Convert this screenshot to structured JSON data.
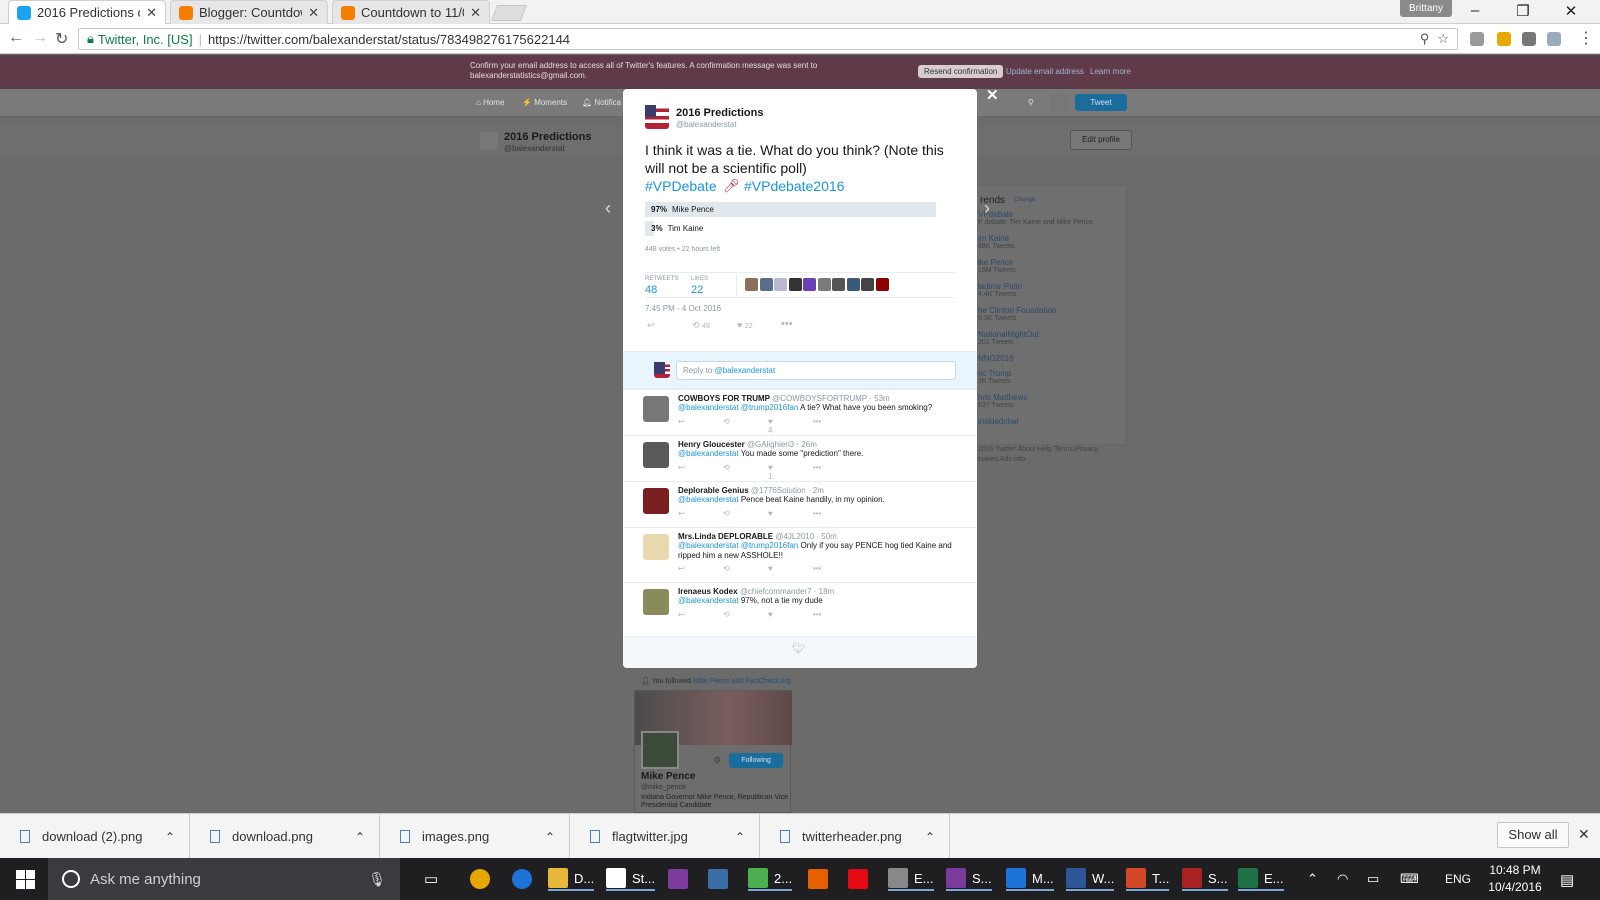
{
  "browser": {
    "tabs": [
      {
        "title": "2016 Predictions on",
        "active": true,
        "icon": "twitter-icon",
        "color": "#1da1f2"
      },
      {
        "title": "Blogger: Countdown",
        "active": false,
        "icon": "blogger-icon",
        "color": "#f57d00"
      },
      {
        "title": "Countdown to 11/0",
        "active": false,
        "icon": "blogger-icon",
        "color": "#f57d00"
      }
    ],
    "profile_name": "Brittany",
    "secure_label": "Twitter, Inc. [US]",
    "url": "https://twitter.com/balexanderstat/status/783498276175622144"
  },
  "twitter_bg": {
    "banner_message": "Confirm your email address to access all of Twitter's features. A confirmation message was sent to balexanderstatistics@gmail.com.",
    "resend_label": "Resend confirmation",
    "update_email_label": "Update email address",
    "learn_more_label": "Learn more",
    "nav": {
      "home": "Home",
      "moments": "Moments",
      "notifications": "Notifica"
    },
    "tweet_button": "Tweet",
    "profile_name": "2016 Predictions",
    "profile_handle": "@balexanderstat",
    "edit_profile": "Edit profile",
    "trends_title": "rends",
    "trends_change": "Change",
    "trends": [
      {
        "name": "VPdebate",
        "sub": "P debate: Tim Kaine and Mike Pence"
      },
      {
        "name": "im Kaine",
        "sub": "88K Tweets"
      },
      {
        "name": "ike Pence",
        "sub": "16M Tweets"
      },
      {
        "name": "ladimir Putin",
        "sub": "4.4K Tweets"
      },
      {
        "name": "he Clinton Foundation",
        "sub": "9.3K Tweets"
      },
      {
        "name": "NationalNightOut",
        "sub": "201 Tweets"
      },
      {
        "name": "NNO2016",
        "sub": ""
      },
      {
        "name": "ric Trump",
        "sub": "3K Tweets"
      },
      {
        "name": "hris Matthews",
        "sub": "637 Tweets"
      },
      {
        "name": "insidedchat",
        "sub": ""
      }
    ],
    "footer_links": "2016 Twitter  About  Help  Terms  Privacy",
    "footer_links2": "ookies  Ads info",
    "followed_prefix": "You followed",
    "followed_names": "Mike Pence and FactCheck.org",
    "card_following": "Following",
    "card_name": "Mike Pence",
    "card_handle": "@mike_pence",
    "card_bio": "Indiana Governor Mike Pence, Republican Vice Presidential Candidate"
  },
  "tweet": {
    "name": "2016 Predictions",
    "handle": "@balexanderstat",
    "text": "I think it was a tie. What do you think? (Note this will not be a scientific poll)",
    "hashtag1": "#VPDebate",
    "hashtag2": "#VPdebate2016",
    "poll": [
      {
        "pct_label": "97%",
        "label": "Mike Pence",
        "fraction": 0.97
      },
      {
        "pct_label": "3%",
        "label": "Tim Kaine",
        "fraction": 0.03
      }
    ],
    "votes": "448 votes • 22 hours left",
    "retweets_label": "RETWEETS",
    "retweets": "48",
    "likes_label": "LIKES",
    "likes": "22",
    "timestamp": "7:45 PM - 4 Oct 2016",
    "action_retweets": "48",
    "action_likes": "22",
    "reply_prefix": "Reply to",
    "reply_handle": "@balexanderstat"
  },
  "replies": [
    {
      "name": "COWBOYS FOR TRUMP",
      "handle": "@COWBOYSFORTRUMP · 53m",
      "mentions": "@balexanderstat @trump2016fan",
      "text": " A tie? What have you been smoking?",
      "likes": "4",
      "retweets": ""
    },
    {
      "name": "Henry Gloucester",
      "handle": "@GAlighieri3 · 26m",
      "mentions": "@balexanderstat",
      "text": " You made some \"prediction\" there.",
      "likes": "1",
      "retweets": ""
    },
    {
      "name": "Deplorable Genius",
      "handle": "@1776Solution · 2m",
      "mentions": "@balexanderstat",
      "text": " Pence beat Kaine handily, in my opinion.",
      "likes": "",
      "retweets": ""
    },
    {
      "name": "Mrs.Linda DEPLORABLE",
      "handle": "@4JL2010 · 50m",
      "mentions": "@balexanderstat @trump2016fan",
      "text": " Only if you say PENCE hog tied Kaine and ripped him a new ASSHOLE!!",
      "likes": "",
      "retweets": ""
    },
    {
      "name": "Irenaeus Kodex",
      "handle": "@chiefcommander7 · 18m",
      "mentions": "@balexanderstat",
      "text": " 97%, not a tie my dude",
      "likes": "",
      "retweets": ""
    }
  ],
  "downloads": [
    {
      "name": "download (2).png"
    },
    {
      "name": "download.png"
    },
    {
      "name": "images.png"
    },
    {
      "name": "flagtwitter.jpg"
    },
    {
      "name": "twitterheader.png"
    }
  ],
  "show_all": "Show all",
  "taskbar": {
    "search_placeholder": "Ask me anything",
    "apps": [
      {
        "label": "D...",
        "color": "#e8b83a",
        "icon": "file-explorer-icon"
      },
      {
        "label": "St...",
        "color": "#ffffff",
        "icon": "store-icon"
      },
      {
        "label": "",
        "color": "#7a3b9c",
        "icon": "onenote-icon"
      },
      {
        "label": "",
        "color": "#3a6ea5",
        "icon": "remote-desktop-icon"
      },
      {
        "label": "2...",
        "color": "#4caf50",
        "icon": "chrome-icon"
      },
      {
        "label": "",
        "color": "#e66000",
        "icon": "firefox-icon"
      },
      {
        "label": "",
        "color": "#e50914",
        "icon": "netflix-icon"
      },
      {
        "label": "E...",
        "color": "#888888",
        "icon": "camera-icon"
      },
      {
        "label": "S...",
        "color": "#7a3b9c",
        "icon": "onenote-icon-2"
      },
      {
        "label": "M...",
        "color": "#1e73d8",
        "icon": "onedrive-icon"
      },
      {
        "label": "W...",
        "color": "#2b5797",
        "icon": "word-icon"
      },
      {
        "label": "T...",
        "color": "#d24726",
        "icon": "powerpoint-icon"
      },
      {
        "label": "S...",
        "color": "#aa2222",
        "icon": "spider-icon"
      },
      {
        "label": "E...",
        "color": "#1e7145",
        "icon": "excel-icon"
      }
    ],
    "language": "ENG",
    "time": "10:48 PM",
    "date": "10/4/2016"
  }
}
